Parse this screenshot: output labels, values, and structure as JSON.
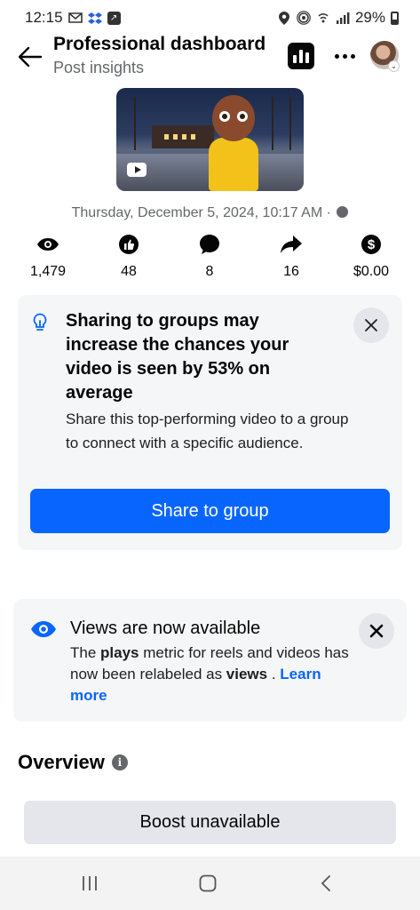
{
  "status_bar": {
    "time": "12:15",
    "battery": "29%",
    "left_icons": [
      "gmail-icon",
      "dropbox-icon",
      "app-notification-icon"
    ],
    "right_icons": [
      "location-icon",
      "hotspot-icon",
      "wifi-icon",
      "signal-icon",
      "battery-icon"
    ]
  },
  "header": {
    "title": "Professional dashboard",
    "subtitle": "Post insights"
  },
  "post": {
    "date": "Thursday, December 5, 2024, 10:17 AM ·",
    "stats": [
      {
        "icon": "eye-icon",
        "value": "1,479"
      },
      {
        "icon": "like-icon",
        "value": "48"
      },
      {
        "icon": "comment-icon",
        "value": "8"
      },
      {
        "icon": "share-icon",
        "value": "16"
      },
      {
        "icon": "dollar-icon",
        "value": "$0.00"
      }
    ]
  },
  "groups_card": {
    "title": "Sharing to groups may increase the chances your video is seen by 53% on average",
    "body": "Share this top-performing video to a group to connect with a specific audience.",
    "button": "Share to group"
  },
  "views_card": {
    "title": "Views are now available",
    "body_prefix": "The ",
    "body_bold1": "plays",
    "body_mid": " metric for reels and videos has now been relabeled as ",
    "body_bold2": "views",
    "body_suffix": " . ",
    "link": "Learn more"
  },
  "overview": {
    "title": "Overview",
    "info_glyph": "i"
  },
  "boost_button": "Boost unavailable",
  "colors": {
    "accent": "#0866ff",
    "card_bg": "#f5f6f7",
    "secondary_text": "#65676b"
  }
}
